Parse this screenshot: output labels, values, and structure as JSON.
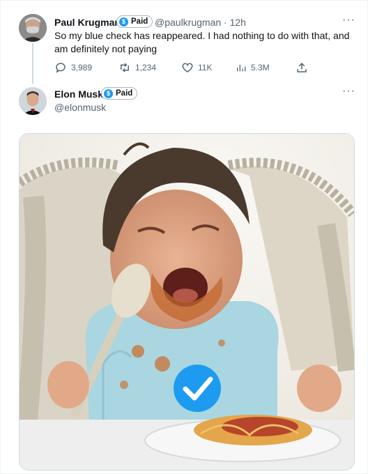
{
  "tweet1": {
    "author_name": "Paul Krugman",
    "badge_label": "Paid",
    "handle": "@paulkrugman",
    "separator": "·",
    "time": "12h",
    "text": "So my blue check has reappeared. I had nothing to do with that, and am definitely not paying",
    "stats": {
      "replies": "3,989",
      "retweets": "1,234",
      "likes": "11K",
      "views": "5.3M"
    },
    "more_glyph": "···"
  },
  "tweet2": {
    "author_name": "Elon Musk",
    "badge_label": "Paid",
    "handle": "@elonmusk",
    "more_glyph": "···"
  },
  "colors": {
    "verified_blue": "#1d9bf0",
    "secondary_text": "#536471"
  }
}
